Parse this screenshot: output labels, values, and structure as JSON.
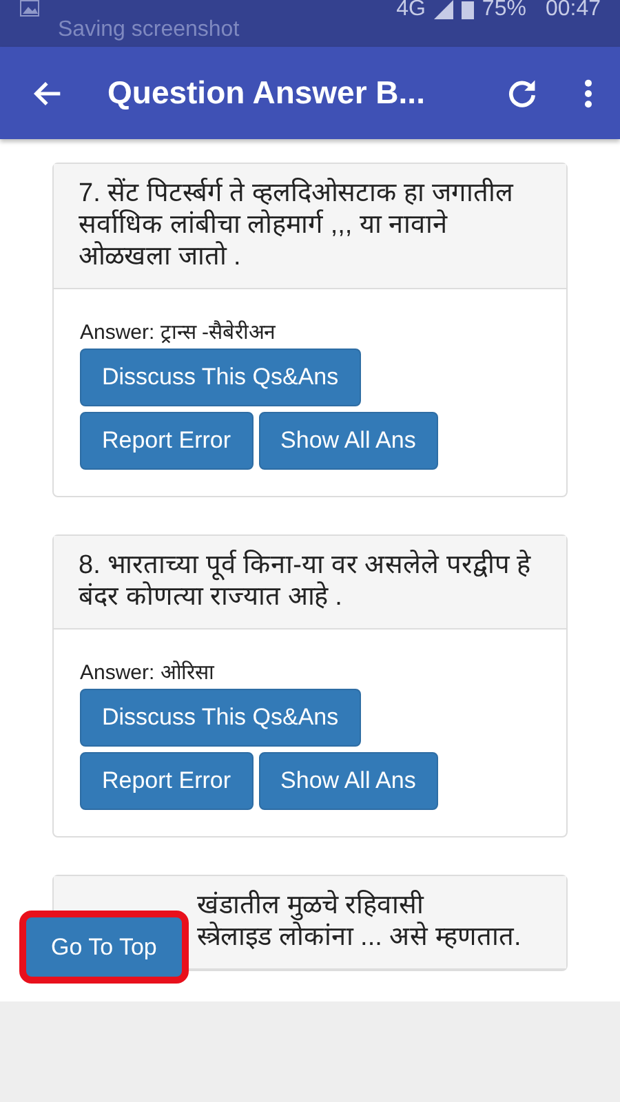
{
  "status_bar": {
    "notification": "Saving screenshot",
    "network": "4G",
    "battery": "75%",
    "time": "00:47"
  },
  "toolbar": {
    "title": "Question Answer B..."
  },
  "questions": [
    {
      "question": "7. सेंट पिटर्स्बर्ग ते व्हलदिओसटाक हा जगातील सर्वाधिक लांबीचा लोहमार्ग ,,, या नावाने ओळखला जातो .",
      "answer": "Answer: ट्रान्स -सैबेरीअन",
      "buttons": [
        "Disscuss This Qs&Ans",
        "Report Error",
        "Show All Ans"
      ]
    },
    {
      "question": "8. भारताच्या पूर्व किना-या वर असलेले परद्वीप हे बंदर कोणत्या राज्यात आहे .",
      "answer": "Answer: ओरिसा",
      "buttons": [
        "Disscuss This Qs&Ans",
        "Report Error",
        "Show All Ans"
      ]
    },
    {
      "question_lines": [
        "खंडातील मुळचे रहिवासी",
        "स्त्रेलाइड लोकांना ... असे म्हणतात."
      ]
    }
  ],
  "go_to_top": {
    "label": "Go To Top",
    "highlighted": true
  }
}
